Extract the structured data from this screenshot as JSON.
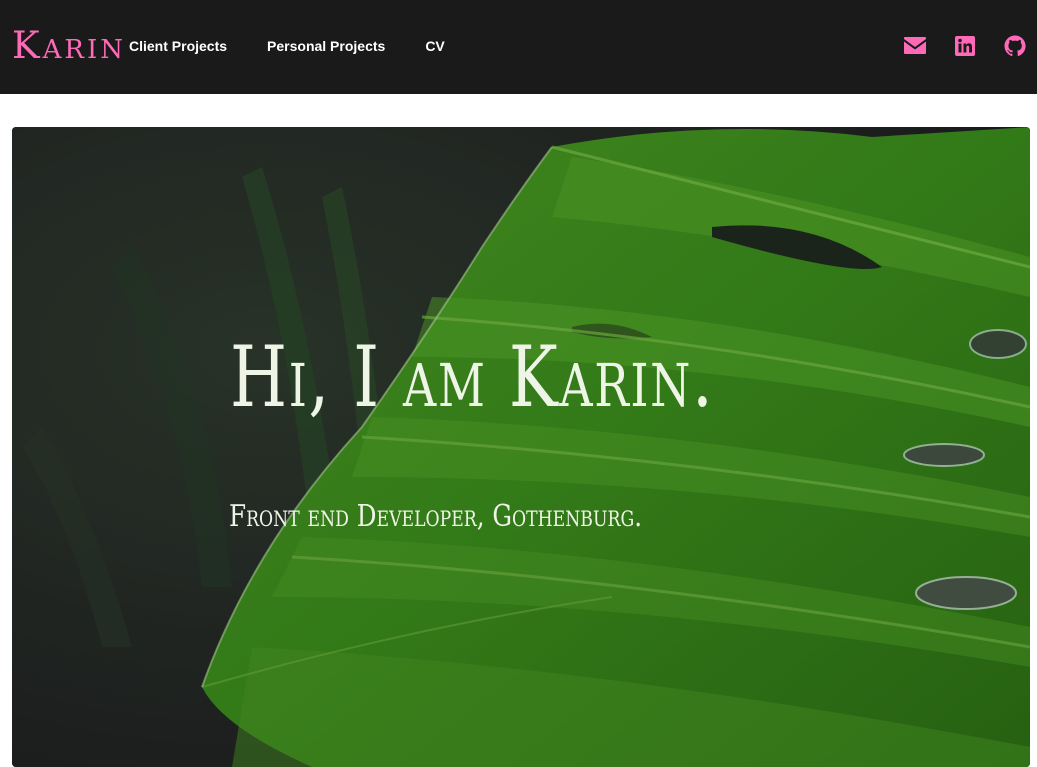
{
  "header": {
    "brand": "Karin",
    "nav": [
      {
        "label": "Client Projects"
      },
      {
        "label": "Personal Projects"
      },
      {
        "label": "CV"
      }
    ],
    "social": [
      {
        "icon": "envelope-icon"
      },
      {
        "icon": "linkedin-icon"
      },
      {
        "icon": "github-icon"
      }
    ]
  },
  "hero": {
    "title": "Hi, I am Karin.",
    "subtitle": "Front end Developer, Gothenburg."
  },
  "colors": {
    "nav_background": "#1a1a1a",
    "accent_pink": "#ff6ab8",
    "hero_text": "#eef5e6",
    "leaf_green": "#3c8c1e"
  }
}
